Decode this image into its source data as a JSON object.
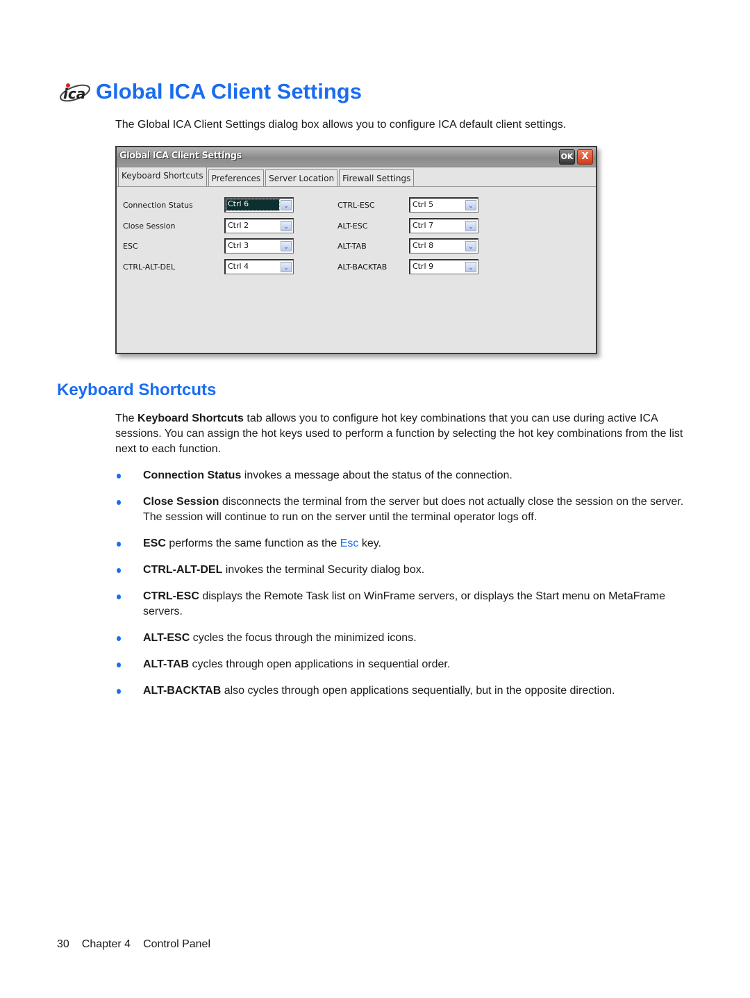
{
  "page": {
    "title": "Global ICA Client Settings",
    "logo_icon": "ica-logo-icon",
    "intro": "The Global ICA Client Settings dialog box allows you to configure ICA default client settings."
  },
  "dialog": {
    "title": "Global ICA Client Settings",
    "ok_label": "OK",
    "close_label": "X",
    "tabs": [
      {
        "label": "Keyboard Shortcuts",
        "active": true
      },
      {
        "label": "Preferences",
        "active": false
      },
      {
        "label": "Server Location",
        "active": false
      },
      {
        "label": "Firewall Settings",
        "active": false
      }
    ],
    "left_fields": [
      {
        "label": "Connection Status",
        "value": "Ctrl 6",
        "focused": true
      },
      {
        "label": "Close Session",
        "value": "Ctrl 2"
      },
      {
        "label": "ESC",
        "value": "Ctrl 3"
      },
      {
        "label": "CTRL-ALT-DEL",
        "value": "Ctrl 4"
      }
    ],
    "right_fields": [
      {
        "label": "CTRL-ESC",
        "value": "Ctrl 5"
      },
      {
        "label": "ALT-ESC",
        "value": "Ctrl 7"
      },
      {
        "label": "ALT-TAB",
        "value": "Ctrl 8"
      },
      {
        "label": "ALT-BACKTAB",
        "value": "Ctrl 9"
      }
    ]
  },
  "section": {
    "heading": "Keyboard Shortcuts",
    "para_pre": "The ",
    "para_bold": "Keyboard Shortcuts",
    "para_post": " tab allows you to configure hot key combinations that you can use during active ICA sessions. You can assign the hot keys used to perform a function by selecting the hot key combinations from the list next to each function.",
    "bullets": [
      {
        "term": "Connection Status",
        "text": " invokes a message about the status of the connection."
      },
      {
        "term": "Close Session",
        "text": " disconnects the terminal from the server but does not actually close the session on the server. The session will continue to run on the server until the terminal operator logs off."
      },
      {
        "term": "ESC",
        "text": " performs the same function as the ",
        "link": "Esc",
        "text_after": " key."
      },
      {
        "term": "CTRL-ALT-DEL",
        "text": " invokes the terminal Security dialog box."
      },
      {
        "term": "CTRL-ESC",
        "text": " displays the Remote Task list on WinFrame servers, or displays the Start menu on MetaFrame servers."
      },
      {
        "term": "ALT-ESC",
        "text": " cycles the focus through the minimized icons."
      },
      {
        "term": "ALT-TAB",
        "text": " cycles through open applications in sequential order."
      },
      {
        "term": "ALT-BACKTAB",
        "text": " also cycles through open applications sequentially, but in the opposite direction."
      }
    ]
  },
  "footer": {
    "page_number": "30",
    "chapter": "Chapter 4",
    "chapter_title": "Control Panel"
  }
}
